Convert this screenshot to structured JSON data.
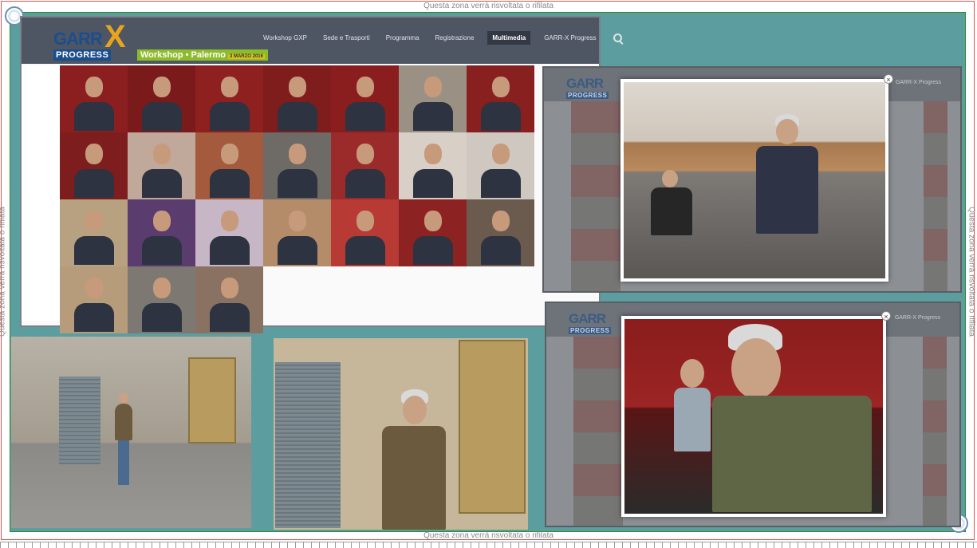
{
  "crop_notes": {
    "top": "Questa zona verrà risvoltata o rifilata",
    "bottom": "Questa zona verrà risvoltata o rifilata",
    "left": "Questa zona verrà risvoltata o rifilata",
    "right": "Questa zona verrà risvoltata o rifilata"
  },
  "site": {
    "logo": {
      "garr": "GARR",
      "x": "X",
      "progress": "PROGRESS"
    },
    "workshop_badge": {
      "label": "Workshop • Palermo",
      "dates": "3 MARZO 2016"
    },
    "nav": [
      {
        "label": "Workshop GXP",
        "active": false
      },
      {
        "label": "Sede e Trasporti",
        "active": false
      },
      {
        "label": "Programma",
        "active": false
      },
      {
        "label": "Registrazione",
        "active": false
      },
      {
        "label": "Multimedia",
        "active": true
      },
      {
        "label": "GARR-X Progress",
        "active": false
      }
    ],
    "icons": {
      "search": "search-icon"
    }
  },
  "photo_tiles": [
    {
      "bg": "#8b1f1f"
    },
    {
      "bg": "#7a1a1a"
    },
    {
      "bg": "#8e2020"
    },
    {
      "bg": "#7f1c1c"
    },
    {
      "bg": "#8a1e1e"
    },
    {
      "bg": "#9a9184"
    },
    {
      "bg": "#892020"
    },
    {
      "bg": "#7d1d1d"
    },
    {
      "bg": "#c0a89a"
    },
    {
      "bg": "#a45a3c"
    },
    {
      "bg": "#6e6a66"
    },
    {
      "bg": "#9b2a2a"
    },
    {
      "bg": "#d8d0c6"
    },
    {
      "bg": "#cfc8c0"
    },
    {
      "bg": "#b7a180"
    },
    {
      "bg": "#5a3c6e"
    },
    {
      "bg": "#c7b6c6"
    },
    {
      "bg": "#b58c6a"
    },
    {
      "bg": "#b73a34"
    },
    {
      "bg": "#8c2222"
    },
    {
      "bg": "#6b5b4e"
    },
    {
      "bg": "#b79c7c"
    },
    {
      "bg": "#7d7872"
    },
    {
      "bg": "#8a7262"
    }
  ],
  "lightboxes": [
    {
      "logo": "GARR",
      "logo_sub": "PROGRESS",
      "nav": "GARR-X Progress",
      "close": "×"
    },
    {
      "logo": "GARR",
      "logo_sub": "PROGRESS",
      "nav": "GARR-X Progress",
      "close": "×"
    }
  ],
  "colors": {
    "background": "#5c9ea0",
    "header": "#4f5663",
    "bleed_line": "#d9534f",
    "safe_line": "#2e8b2e",
    "accent_green": "#8cbc2a",
    "logo_blue": "#1b4e8c",
    "logo_orange": "#e9a41d"
  }
}
